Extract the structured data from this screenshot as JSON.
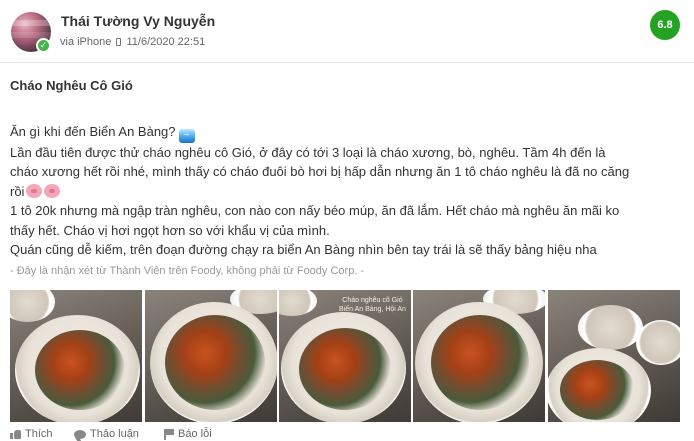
{
  "review": {
    "user_name": "Thái Tường Vy Nguyễn",
    "via": "via iPhone",
    "timestamp": "11/6/2020 22:51",
    "score": "6.8",
    "title": "Cháo Nghêu Cô Gió",
    "lines": [
      "Ăn gì khi đến Biển An Bàng?",
      "Lần đầu tiên được thử cháo nghêu cô Gió, ở đây có tới 3 loại là cháo xương, bò, nghêu. Tầm 4h đến là",
      "cháo xương hết rồi nhé, mình thấy có cháo đuôi bò hơi bị hấp dẫn nhưng ăn 1 tô cháo nghêu là đã no căng",
      "rồi",
      "1 tô 20k nhưng mà ngập tràn nghêu, con nào con nấy béo múp, ăn đã lắm. Hết cháo mà nghêu ăn mãi ko",
      "thấy hết. Cháo vị hơi ngọt hơn so với khẩu vị của mình.",
      "Quán cũng dễ kiếm, trên đoạn đường chạy ra biển An Bàng nhìn bên tay trái là sẽ thấy bảng hiệu nha"
    ],
    "disclaimer": "- Đây là nhận xét từ Thành Viên trên Foody, không phải từ Foody Corp. -",
    "photo_caption": [
      "Cháo nghêu cô Gió",
      "Biển An Bàng, Hội An"
    ],
    "photo_icons": [
      "photo-1",
      "photo-2",
      "photo-3",
      "photo-4",
      "photo-5"
    ]
  },
  "actions": {
    "like_label": "Thích",
    "discuss_label": "Thảo luận",
    "report_label": "Báo lỗi"
  },
  "colors": {
    "score_bg": "#23a223",
    "verified_bg": "#45b649",
    "text": "#333333",
    "muted": "#999999"
  }
}
